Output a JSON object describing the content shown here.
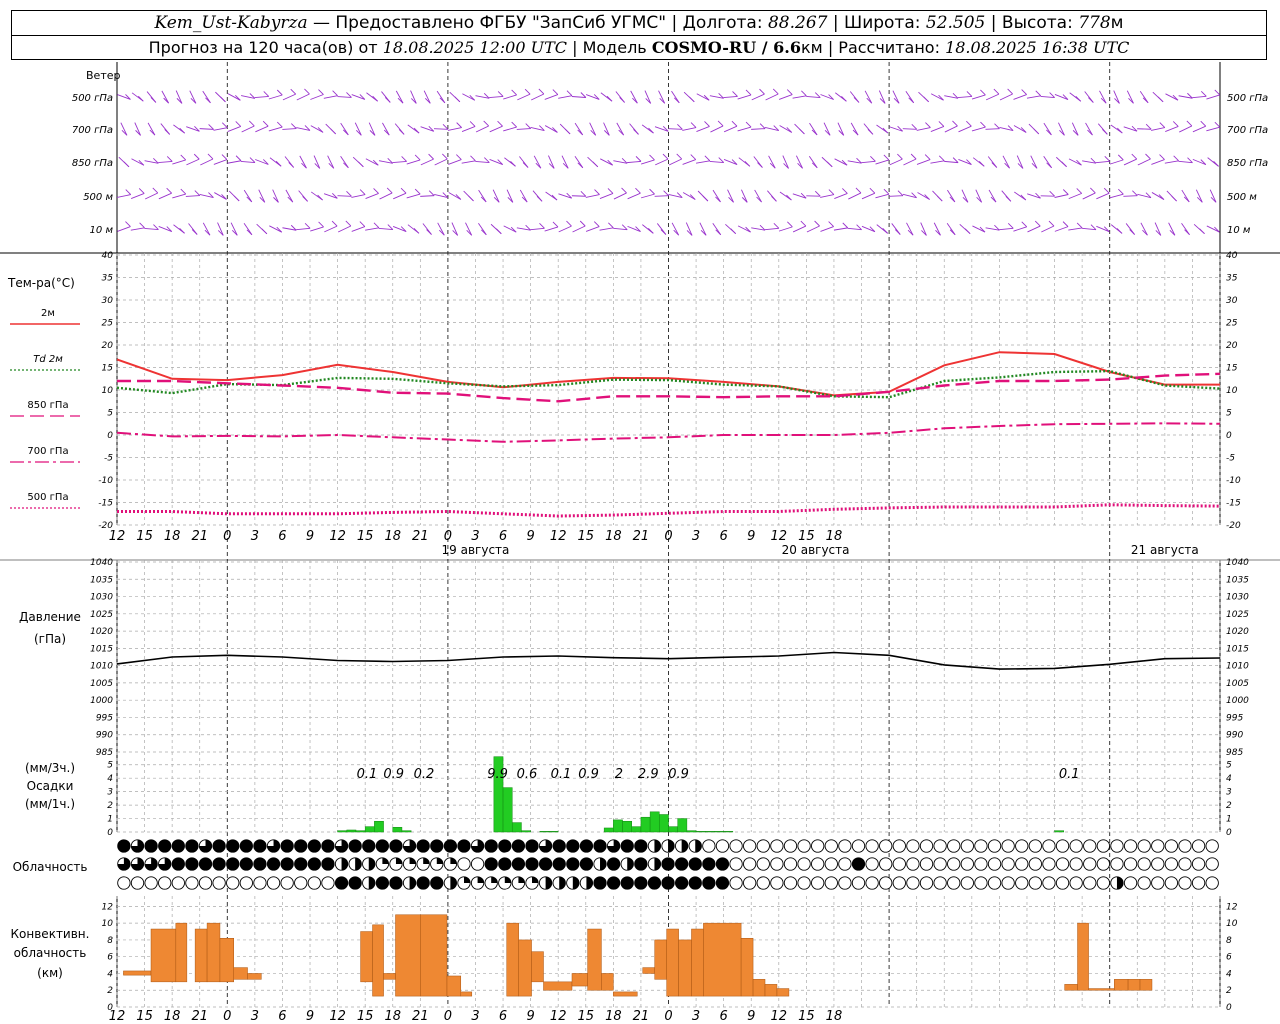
{
  "header": {
    "station": "Kem_Ust-Kabyrza",
    "provider": "— Предоставлено ФГБУ \"ЗапСиб УГМС\"",
    "lon_label": "Долгота:",
    "lon": "88.267",
    "lat_label": "Широта:",
    "lat": "52.505",
    "alt_label": "Высота:",
    "alt": "778",
    "alt_unit": "м",
    "forecast_label": "Прогноз на 120 часа(ов) от",
    "forecast_from": "18.08.2025 12:00 UTC",
    "model_label": "Модель",
    "model": "COSMO-RU / 6.6",
    "model_unit": "км",
    "calc_label": "Рассчитано:",
    "calc_time": "18.08.2025 16:38 UTC"
  },
  "chart_data": [
    {
      "type": "wind-barbs",
      "title": "Ветер",
      "levels": [
        "500 гПа",
        "700 гПа",
        "850 гПа",
        "500 м",
        "10 м"
      ],
      "x_hours": [
        0,
        120
      ]
    },
    {
      "type": "line",
      "ylabel": "Тем-ра(°C)",
      "ylim": [
        -20,
        40
      ],
      "yticks": [
        -20,
        -15,
        -10,
        -5,
        0,
        5,
        10,
        15,
        20,
        25,
        30,
        35,
        40
      ],
      "grid": true,
      "legend_placement": "left",
      "legend": [
        "2м",
        "Td 2м",
        "850 гПа",
        "700 гПа",
        "500 гПа"
      ],
      "colors": {
        "t2m": "#ee3333",
        "td2m": "#228822",
        "t850": "#e0107a",
        "t700": "#e0107a",
        "t500": "#e0107a"
      },
      "x": [
        0,
        6,
        12,
        18,
        24,
        30,
        36,
        42,
        48,
        54,
        60,
        66,
        72,
        78,
        84,
        90,
        96,
        102,
        108,
        114,
        120
      ],
      "series": [
        {
          "name": "2м",
          "values": [
            16.8,
            12.5,
            12.2,
            13.3,
            15.6,
            14,
            11.8,
            10.6,
            11.8,
            12.7,
            12.6,
            11.8,
            10.8,
            8.8,
            9.6,
            15.5,
            18.4,
            18,
            14,
            11.2,
            11.2
          ]
        },
        {
          "name": "Td 2м",
          "values": [
            10.5,
            9.3,
            11.3,
            11.1,
            12.7,
            12.5,
            11.5,
            10.8,
            11.1,
            12.3,
            12.2,
            11.2,
            10.8,
            8.6,
            8.4,
            12,
            12.8,
            14,
            14.2,
            11,
            10.3
          ]
        },
        {
          "name": "850 гПа",
          "values": [
            12,
            12,
            11.5,
            11,
            10.5,
            9.4,
            9.2,
            8.2,
            7.5,
            8.6,
            8.6,
            8.4,
            8.6,
            8.6,
            9.6,
            11,
            12,
            12,
            12.3,
            13.2,
            13.6
          ]
        },
        {
          "name": "700 гПа",
          "values": [
            0.5,
            -0.3,
            -0.2,
            -0.3,
            0,
            -0.5,
            -1,
            -1.5,
            -1.2,
            -0.8,
            -0.5,
            0,
            0,
            0,
            0.5,
            1.5,
            2,
            2.4,
            2.5,
            2.6,
            2.5
          ]
        },
        {
          "name": "500 гПа",
          "values": [
            -17,
            -17,
            -17.5,
            -17.5,
            -17.5,
            -17.2,
            -17,
            -17.5,
            -18,
            -17.8,
            -17.4,
            -17,
            -17,
            -16.5,
            -16.2,
            -16,
            -16,
            -16,
            -15.5,
            -15.7,
            -15.8
          ]
        }
      ]
    },
    {
      "type": "line",
      "ylabel": "Давление (гПа)",
      "ylim": [
        985,
        1040
      ],
      "yticks": [
        985,
        990,
        995,
        1000,
        1005,
        1010,
        1015,
        1020,
        1025,
        1030,
        1035,
        1040
      ],
      "grid": true,
      "x": [
        0,
        6,
        12,
        18,
        24,
        30,
        36,
        42,
        48,
        54,
        60,
        66,
        72,
        78,
        84,
        90,
        96,
        102,
        108,
        114,
        120
      ],
      "series": [
        {
          "values": [
            1010.5,
            1012.5,
            1013,
            1012.5,
            1011.5,
            1011.2,
            1011.5,
            1012.5,
            1012.8,
            1012.3,
            1012,
            1012.4,
            1012.8,
            1013.8,
            1013,
            1010.2,
            1009,
            1009.2,
            1010.4,
            1012,
            1012.2
          ]
        }
      ]
    },
    {
      "type": "bar",
      "ylabel": "(мм/3ч.) Осадки (мм/1ч.)",
      "ylim": [
        0,
        6
      ],
      "yticks": [
        0,
        1,
        2,
        3,
        4,
        5
      ],
      "color": "#22cc22",
      "x_hours": [
        24,
        25,
        26,
        27,
        28,
        30,
        31,
        41,
        42,
        43,
        44,
        46,
        47,
        53,
        54,
        55,
        56,
        57,
        58,
        59,
        60,
        61,
        62,
        63,
        64,
        65,
        66,
        102
      ],
      "values": [
        0.1,
        0.15,
        0.1,
        0.4,
        0.8,
        0.35,
        0.1,
        6.3,
        3.3,
        0.7,
        0.1,
        0.05,
        0.05,
        0.3,
        0.9,
        0.8,
        0.4,
        1.1,
        1.5,
        1.3,
        0.4,
        1.0,
        0.1,
        0.05,
        0.05,
        0.05,
        0.05,
        0.1
      ],
      "annotations": [
        {
          "x_hour": 27.2,
          "text": "0.1"
        },
        {
          "x_hour": 30.1,
          "text": "0.9"
        },
        {
          "x_hour": 33.4,
          "text": "0.2"
        },
        {
          "x_hour": 41.4,
          "text": "9.9"
        },
        {
          "x_hour": 44.6,
          "text": "0.6"
        },
        {
          "x_hour": 48.3,
          "text": "0.1"
        },
        {
          "x_hour": 51.3,
          "text": "0.9"
        },
        {
          "x_hour": 54.6,
          "text": "2"
        },
        {
          "x_hour": 57.8,
          "text": "2.9"
        },
        {
          "x_hour": 61.1,
          "text": "0.9"
        },
        {
          "x_hour": 103.6,
          "text": "0.1"
        }
      ]
    },
    {
      "type": "cloud-cover",
      "ylabel": "Облачность",
      "rows": 3,
      "x_hours": [
        0,
        120
      ]
    },
    {
      "type": "bar",
      "ylabel": "Конвективн. облачность (км)",
      "ylim": [
        0,
        13
      ],
      "yticks": [
        0,
        2,
        4,
        6,
        8,
        10,
        12
      ],
      "color": "#ee8833",
      "bars": [
        {
          "x0": 0.7,
          "x1": 3.7,
          "base": 3.8,
          "top": 4.3
        },
        {
          "x0": 3.7,
          "x1": 6.4,
          "base": 3,
          "top": 9.3
        },
        {
          "x0": 6.4,
          "x1": 7.6,
          "base": 3,
          "top": 10
        },
        {
          "x0": 8.5,
          "x1": 9.8,
          "base": 3,
          "top": 9.3
        },
        {
          "x0": 9.8,
          "x1": 11.2,
          "base": 3,
          "top": 10
        },
        {
          "x0": 11.2,
          "x1": 12.7,
          "base": 3,
          "top": 8.2
        },
        {
          "x0": 12.7,
          "x1": 14.2,
          "base": 3.3,
          "top": 4.7
        },
        {
          "x0": 14.2,
          "x1": 15.7,
          "base": 3.3,
          "top": 4
        },
        {
          "x0": 26.5,
          "x1": 27.8,
          "base": 3,
          "top": 9
        },
        {
          "x0": 27.8,
          "x1": 29,
          "base": 1.3,
          "top": 9.8
        },
        {
          "x0": 29,
          "x1": 30.3,
          "base": 3.3,
          "top": 4
        },
        {
          "x0": 30.3,
          "x1": 33,
          "base": 1.3,
          "top": 11
        },
        {
          "x0": 33,
          "x1": 35.9,
          "base": 1.3,
          "top": 11
        },
        {
          "x0": 35.9,
          "x1": 37.4,
          "base": 1.3,
          "top": 3.7
        },
        {
          "x0": 37.4,
          "x1": 38.6,
          "base": 1.3,
          "top": 1.8
        },
        {
          "x0": 42.4,
          "x1": 43.7,
          "base": 1.3,
          "top": 10
        },
        {
          "x0": 43.7,
          "x1": 45.1,
          "base": 1.3,
          "top": 8
        },
        {
          "x0": 45.1,
          "x1": 46.4,
          "base": 3,
          "top": 6.6
        },
        {
          "x0": 46.4,
          "x1": 49.5,
          "base": 2,
          "top": 3
        },
        {
          "x0": 49.5,
          "x1": 51.2,
          "base": 2.5,
          "top": 4
        },
        {
          "x0": 51.2,
          "x1": 52.7,
          "base": 2,
          "top": 9.3
        },
        {
          "x0": 52.7,
          "x1": 54,
          "base": 2,
          "top": 4
        },
        {
          "x0": 54,
          "x1": 56.6,
          "base": 1.3,
          "top": 1.8
        },
        {
          "x0": 57.2,
          "x1": 58.5,
          "base": 4,
          "top": 4.7
        },
        {
          "x0": 58.5,
          "x1": 59.8,
          "base": 3.3,
          "top": 8
        },
        {
          "x0": 59.8,
          "x1": 61.1,
          "base": 1.3,
          "top": 9.3
        },
        {
          "x0": 61.1,
          "x1": 62.5,
          "base": 1.3,
          "top": 8
        },
        {
          "x0": 62.5,
          "x1": 63.8,
          "base": 1.3,
          "top": 9.3
        },
        {
          "x0": 63.8,
          "x1": 67.9,
          "base": 1.3,
          "top": 10
        },
        {
          "x0": 67.9,
          "x1": 69.2,
          "base": 1.3,
          "top": 8.2
        },
        {
          "x0": 69.2,
          "x1": 70.5,
          "base": 1.3,
          "top": 3.3
        },
        {
          "x0": 70.5,
          "x1": 71.8,
          "base": 1.3,
          "top": 2.7
        },
        {
          "x0": 71.8,
          "x1": 73.1,
          "base": 1.3,
          "top": 2.2
        },
        {
          "x0": 103.1,
          "x1": 104.5,
          "base": 2,
          "top": 2.7
        },
        {
          "x0": 104.5,
          "x1": 105.7,
          "base": 2,
          "top": 10
        },
        {
          "x0": 105.7,
          "x1": 108.5,
          "base": 2,
          "top": 2.2
        },
        {
          "x0": 108.5,
          "x1": 110,
          "base": 2,
          "top": 3.3
        },
        {
          "x0": 110,
          "x1": 111.3,
          "base": 2,
          "top": 3.3
        },
        {
          "x0": 111.3,
          "x1": 112.6,
          "base": 2,
          "top": 3.3
        }
      ]
    }
  ],
  "x_axis": {
    "tick_labels": [
      "12",
      "15",
      "18",
      "21",
      "0",
      "3",
      "6",
      "9",
      "12",
      "15",
      "18",
      "21",
      "0",
      "3",
      "6",
      "9",
      "12",
      "15",
      "18",
      "21",
      "0",
      "3",
      "6",
      "9",
      "12",
      "15",
      "18"
    ],
    "dates": [
      {
        "x_hour": 39,
        "text": "19 августа"
      },
      {
        "x_hour": 76,
        "text": "20 августа"
      },
      {
        "x_hour": 114,
        "text": "21 августа"
      }
    ]
  }
}
